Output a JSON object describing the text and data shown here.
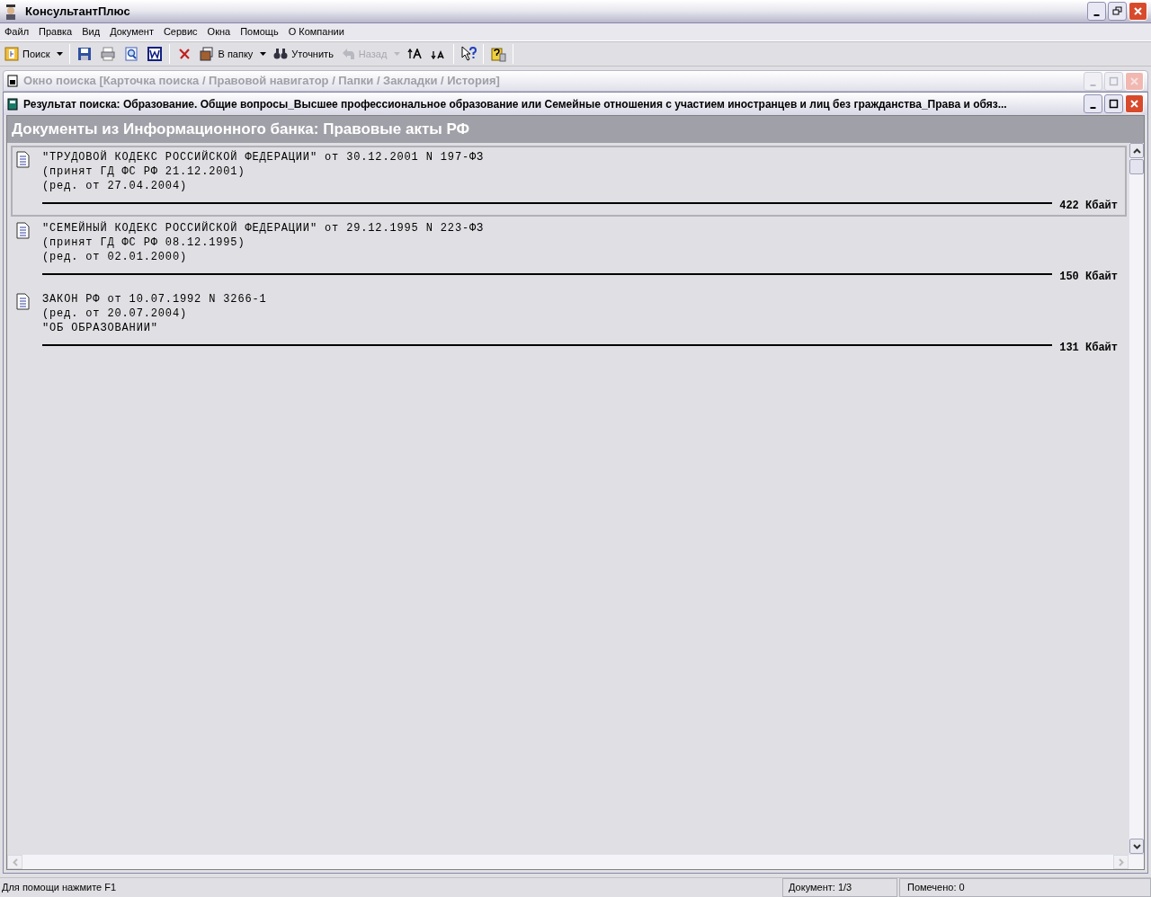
{
  "window": {
    "title": "КонсультантПлюс"
  },
  "menu": [
    "Файл",
    "Правка",
    "Вид",
    "Документ",
    "Сервис",
    "Окна",
    "Помощь",
    "О Компании"
  ],
  "toolbar": [
    {
      "label": "Поиск",
      "dropdown": true,
      "disabled": false
    },
    {
      "label": "В папку",
      "dropdown": true,
      "disabled": false
    },
    {
      "label": "Уточнить",
      "dropdown": false,
      "disabled": false
    },
    {
      "label": "Назад",
      "dropdown": true,
      "disabled": true
    }
  ],
  "search_window": {
    "title": "Окно поиска [Карточка поиска / Правовой навигатор / Папки / Закладки / История]",
    "active": false
  },
  "result_window": {
    "title": "Результат поиска: Образование. Общие вопросы_Высшее профессиональное образование или Семейные отношения с участием иностранцев и лиц без гражданства_Права и обяз...",
    "active": true
  },
  "header": "Документы из Информационного банка: Правовые акты РФ",
  "documents": [
    {
      "lines": [
        "\"ТРУДОВОЙ КОДЕКС РОССИЙСКОЙ ФЕДЕРАЦИИ\" от 30.12.2001 N 197-ФЗ",
        "(принят ГД ФС РФ 21.12.2001)",
        "(ред. от 27.04.2004)"
      ],
      "size": "422 Кбайт",
      "selected": true
    },
    {
      "lines": [
        "\"СЕМЕЙНЫЙ КОДЕКС РОССИЙСКОЙ ФЕДЕРАЦИИ\" от 29.12.1995 N 223-ФЗ",
        "(принят ГД ФС РФ 08.12.1995)",
        "(ред. от 02.01.2000)"
      ],
      "size": "150 Кбайт",
      "selected": false
    },
    {
      "lines": [
        "ЗАКОН РФ от 10.07.1992 N 3266-1",
        "(ред. от 20.07.2004)",
        "\"ОБ ОБРАЗОВАНИИ\""
      ],
      "size": "131 Кбайт",
      "selected": false
    }
  ],
  "status_bar": {
    "hint": "Для помощи нажмите F1",
    "document": "Документ: 1/3",
    "marked": "Помечено: 0"
  }
}
